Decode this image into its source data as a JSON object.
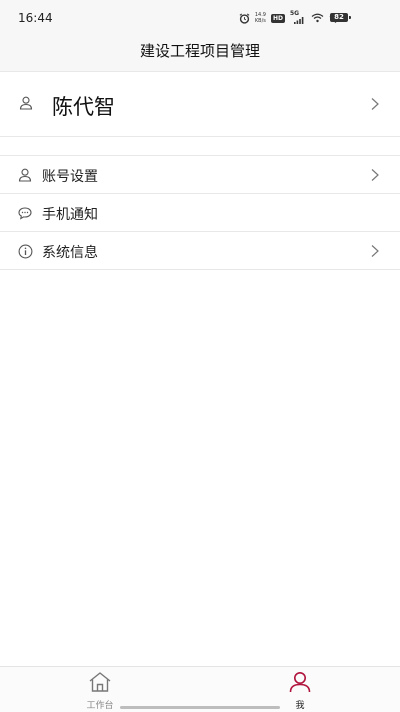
{
  "status_bar": {
    "time": "16:44",
    "net_speed_value": "14.9",
    "net_speed_unit": "KB/s",
    "hd_badge": "HD",
    "network_type": "5G",
    "battery_level": "82",
    "icons": [
      "alarm-icon",
      "signal-icon",
      "wifi-icon",
      "battery-icon"
    ]
  },
  "header": {
    "title": "建设工程项目管理"
  },
  "profile": {
    "name": "陈代智",
    "icon": "user-icon"
  },
  "menu": {
    "items": [
      {
        "label": "账号设置",
        "icon": "user-icon",
        "has_arrow": true
      },
      {
        "label": "手机通知",
        "icon": "chat-bubble-icon",
        "has_arrow": false
      },
      {
        "label": "系统信息",
        "icon": "info-icon",
        "has_arrow": true
      }
    ]
  },
  "tab_bar": {
    "tabs": [
      {
        "label": "工作台",
        "icon": "home-icon",
        "active": false
      },
      {
        "label": "我",
        "icon": "person-icon",
        "active": true
      }
    ],
    "active_color": "#b0143c",
    "inactive_color": "#888888"
  }
}
